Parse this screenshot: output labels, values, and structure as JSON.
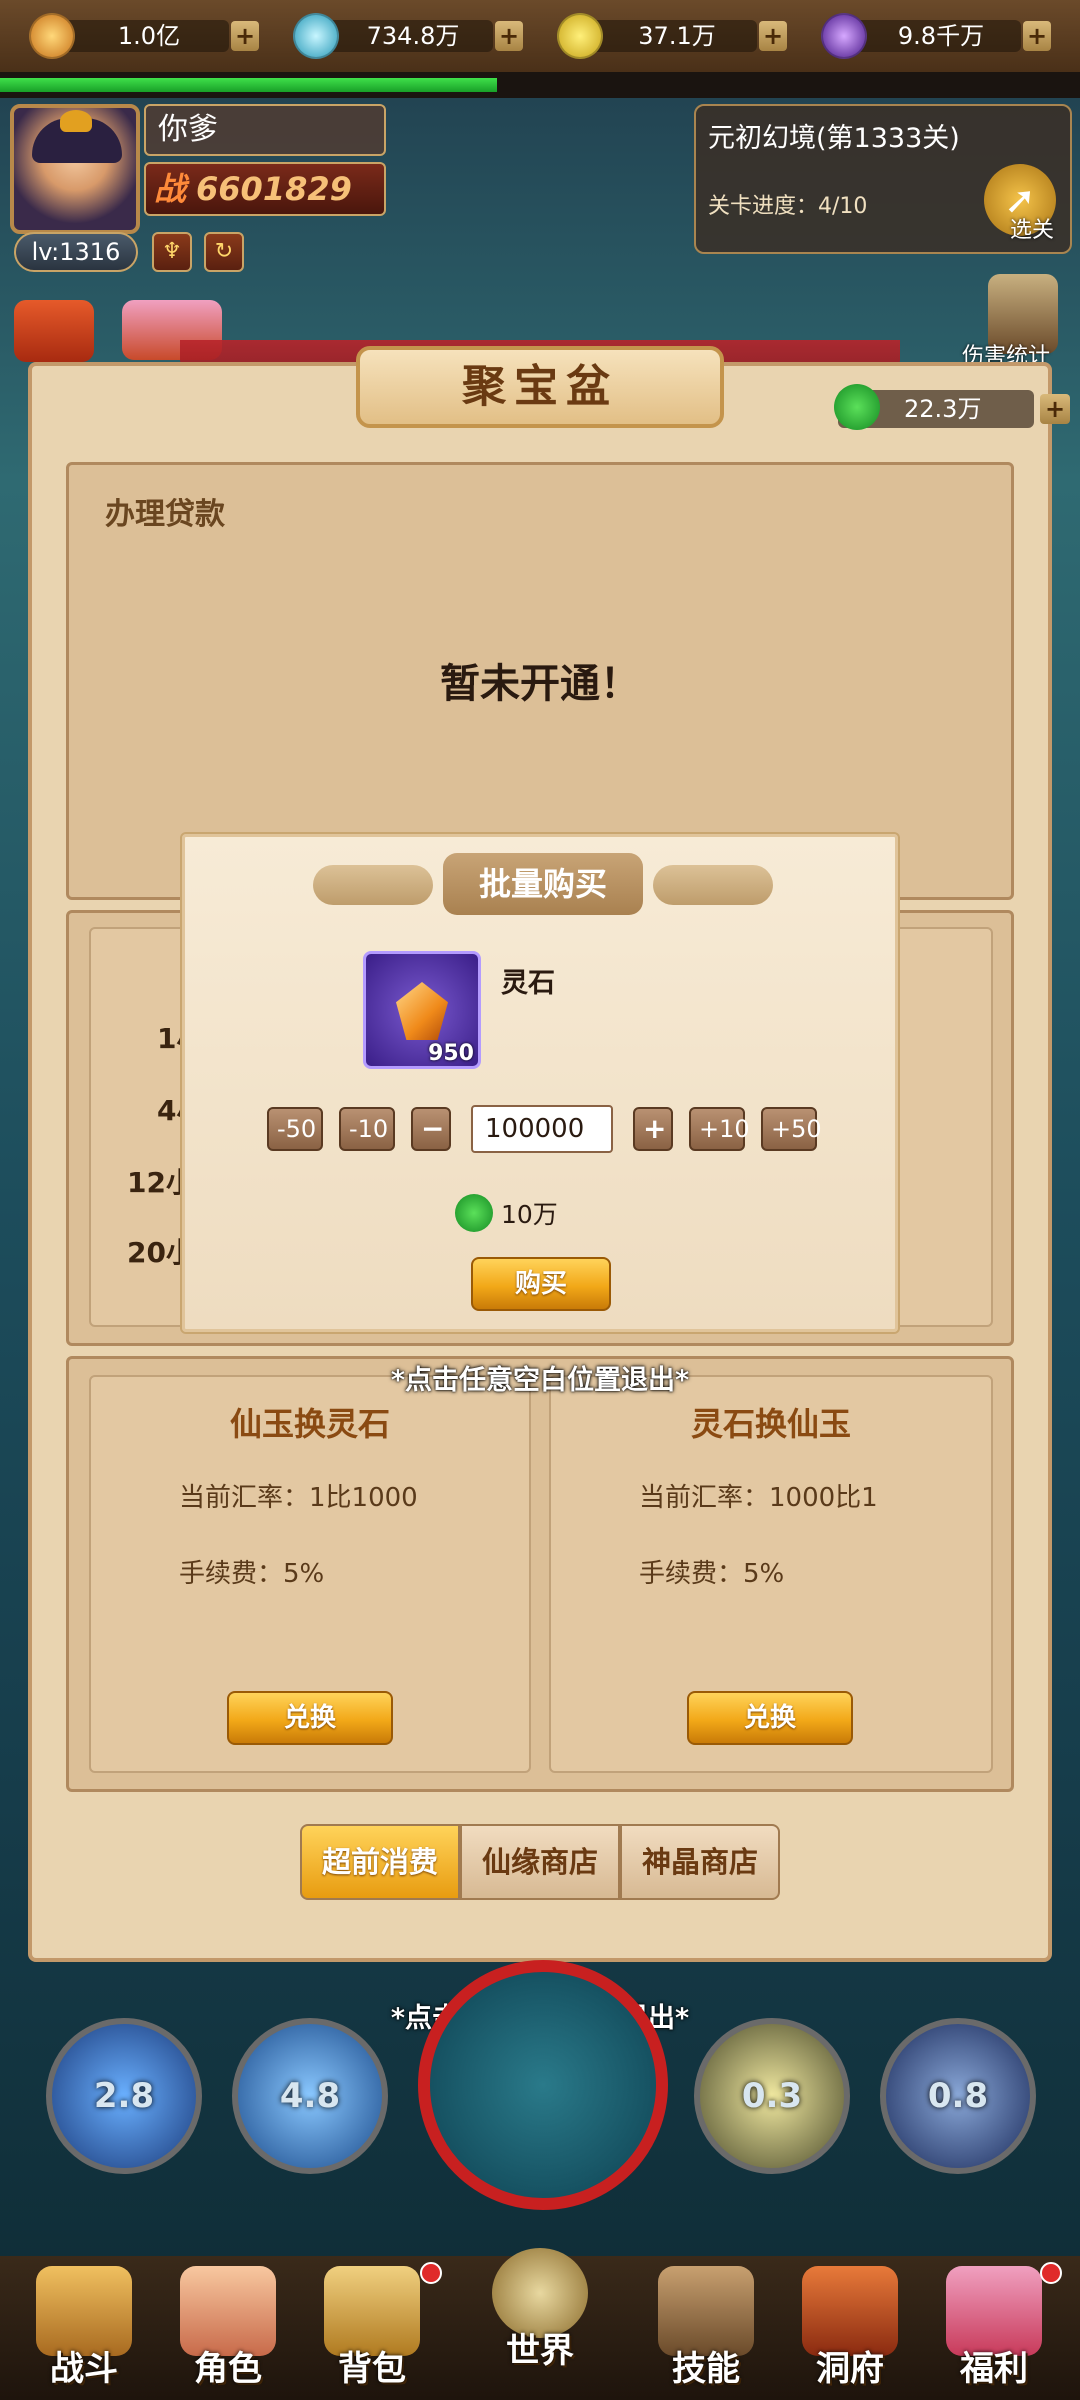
{
  "resources": [
    {
      "value": "1.0亿",
      "icon": "gold-ingot-icon",
      "color": "#e8a23a"
    },
    {
      "value": "734.8万",
      "icon": "spirit-orb-icon",
      "color": "#4fc7d6"
    },
    {
      "value": "37.1万",
      "icon": "ruyi-coin-icon",
      "color": "#e9c53a"
    },
    {
      "value": "9.8千万",
      "icon": "purple-orb-icon",
      "color": "#8a4ad6"
    }
  ],
  "exp_progress": 0.46,
  "player": {
    "name": "你爹",
    "power_prefix": "战",
    "power": "6601829",
    "level": "lv:1316"
  },
  "stage": {
    "title": "元初幻境(第1333关)",
    "progress": "关卡进度：4/10",
    "select_label": "选关"
  },
  "side_labels": {
    "damage_stats": "伤害统计"
  },
  "panel": {
    "title": "聚宝盆",
    "currency_value": "22.3万",
    "loan_title": "办理贷款",
    "loan_message": "暂未开通！",
    "hours": [
      "1小",
      "4小",
      "12小",
      "20小"
    ]
  },
  "exchange": {
    "left": {
      "title": "仙玉换灵石",
      "rate": "当前汇率：1比1000",
      "fee": "手续费：5%",
      "button": "兑换"
    },
    "right": {
      "title": "灵石换仙玉",
      "rate": "当前汇率：1000比1",
      "fee": "手续费：5%",
      "button": "兑换"
    }
  },
  "tabs": [
    "超前消费",
    "仙缘商店",
    "神晶商店"
  ],
  "modal": {
    "title": "批量购买",
    "item_name": "灵石",
    "item_count": "950",
    "qty_buttons": {
      "m50": "-50",
      "m10": "-10",
      "minus": "−",
      "plus": "+",
      "p10": "+10",
      "p50": "+50"
    },
    "quantity": "100000",
    "price": "10万",
    "buy_label": "购买"
  },
  "exit_hint": "*点击任意空白位置退出*",
  "skills": [
    {
      "cooldown": "2.8",
      "color": "#2a5aa8"
    },
    {
      "cooldown": "4.8",
      "color": "#3a6ab8"
    },
    {
      "cooldown": "0.3",
      "color": "#7a7a5a"
    },
    {
      "cooldown": "0.8",
      "color": "#3a5a9a"
    }
  ],
  "nav": [
    "战斗",
    "角色",
    "背包",
    "世界",
    "技能",
    "洞府",
    "福利"
  ]
}
